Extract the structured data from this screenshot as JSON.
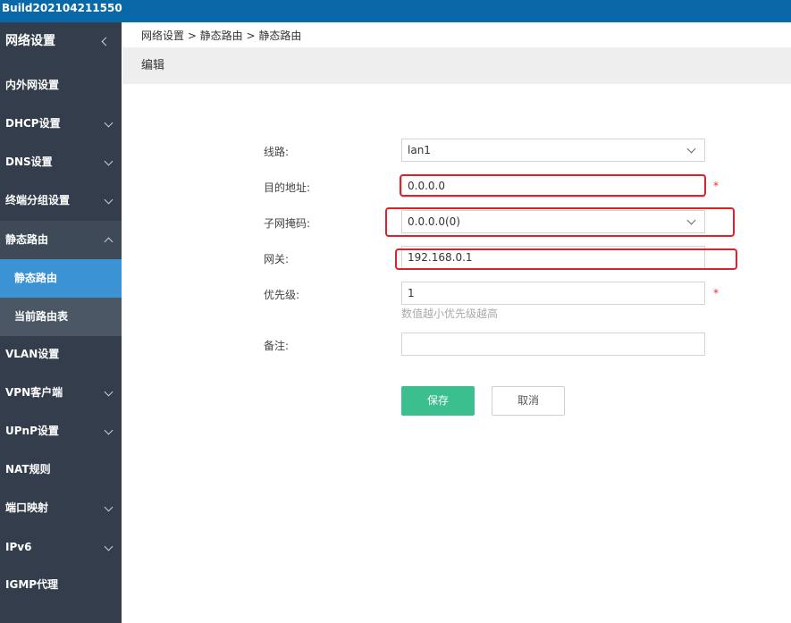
{
  "header": {
    "build": "Build202104211550"
  },
  "sidebar": {
    "title": "网络设置",
    "items": [
      {
        "label": "内外网设置"
      },
      {
        "label": "DHCP设置"
      },
      {
        "label": "DNS设置"
      },
      {
        "label": "终端分组设置"
      },
      {
        "label": "静态路由"
      },
      {
        "label": "静态路由"
      },
      {
        "label": "当前路由表"
      },
      {
        "label": "VLAN设置"
      },
      {
        "label": "VPN客户端"
      },
      {
        "label": "UPnP设置"
      },
      {
        "label": "NAT规则"
      },
      {
        "label": "端口映射"
      },
      {
        "label": "IPv6"
      },
      {
        "label": "IGMP代理"
      }
    ]
  },
  "breadcrumb": "网络设置 > 静态路由 > 静态路由",
  "panel": {
    "title": "编辑"
  },
  "form": {
    "line": {
      "label": "线路:",
      "value": "lan1"
    },
    "dest": {
      "label": "目的地址:",
      "value": "0.0.0.0"
    },
    "mask": {
      "label": "子网掩码:",
      "value": "0.0.0.0(0)"
    },
    "gateway": {
      "label": "网关:",
      "value": "192.168.0.1"
    },
    "priority": {
      "label": "优先级:",
      "value": "1",
      "hint": "数值越小优先级越高"
    },
    "remark": {
      "label": "备注:",
      "value": ""
    },
    "required_mark": "*"
  },
  "buttons": {
    "save": "保存",
    "cancel": "取消"
  },
  "colors": {
    "topbar": "#0968a8",
    "sidebar": "#333d4b",
    "active": "#3b93d4",
    "save": "#3cbf8e",
    "highlight": "#e0202a"
  }
}
